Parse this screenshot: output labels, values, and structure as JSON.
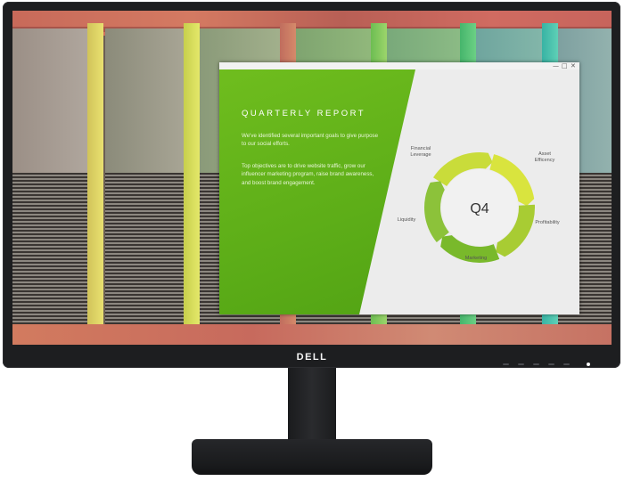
{
  "monitor": {
    "brand_logo": "DELL"
  },
  "window": {
    "controls": [
      "—",
      "□",
      "✕"
    ]
  },
  "report": {
    "title": "QUARTERLY REPORT",
    "paragraph1": "We've identified several important goals to give purpose to our social efforts.",
    "paragraph2": "Top objectives are to drive website traffic, grow our influencer marketing program, raise brand awareness, and boost brand engagement."
  },
  "chart_data": {
    "type": "cycle-diagram",
    "center_label": "Q4",
    "segments": [
      "Financial Leverage",
      "Asset Efficency",
      "Profitability",
      "Marketing",
      "Liquidity"
    ],
    "labels": {
      "financial_leverage": "Financial\nLeverage",
      "asset_efficency": "Asset\nEfficency",
      "profitability": "Profitability",
      "marketing": "Marketing",
      "liquidity": "Liquidity"
    },
    "colors": [
      "#c9dc3a",
      "#d9e43e",
      "#a8cc33",
      "#79b92b",
      "#8cc23a"
    ]
  },
  "colors": {
    "accent_green": "#5aab17",
    "bezel": "#1d1e20"
  }
}
